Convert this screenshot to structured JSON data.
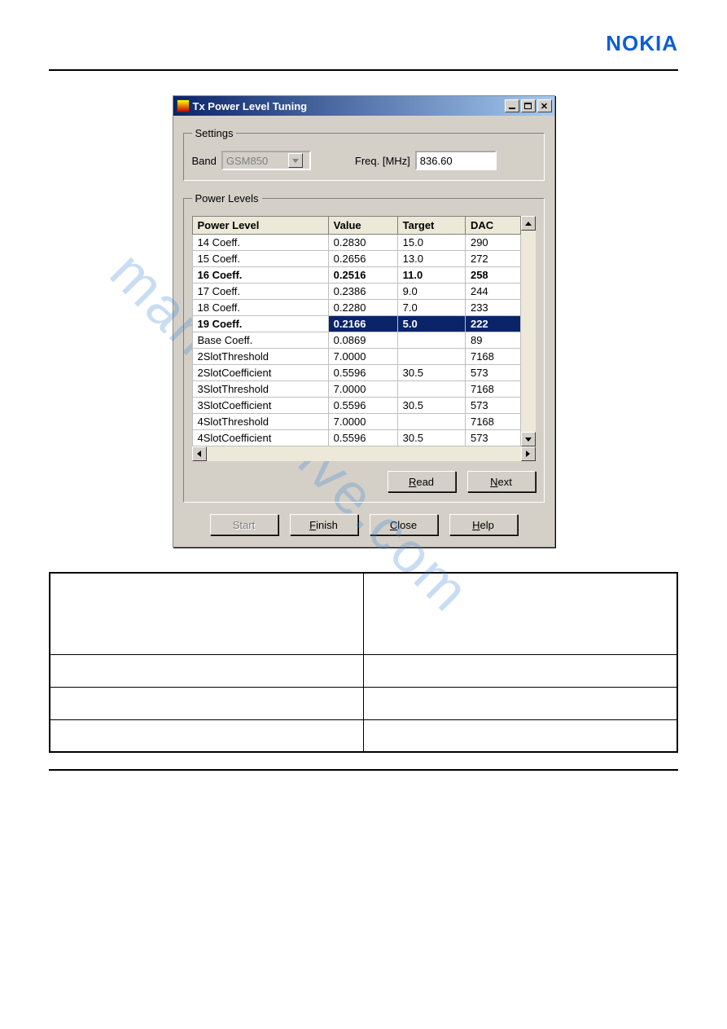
{
  "brand": "NOKIA",
  "watermark": "manualshive.com",
  "dialog": {
    "title": "Tx Power Level Tuning",
    "settings": {
      "legend": "Settings",
      "band_label": "Band",
      "band_value": "GSM850",
      "freq_label": "Freq. [MHz]",
      "freq_value": "836.60"
    },
    "power": {
      "legend": "Power Levels",
      "headers": [
        "Power Level",
        "Value",
        "Target",
        "DAC"
      ],
      "rows": [
        {
          "c": [
            "14 Coeff.",
            "0.2830",
            "15.0",
            "290"
          ],
          "style": ""
        },
        {
          "c": [
            "15 Coeff.",
            "0.2656",
            "13.0",
            "272"
          ],
          "style": ""
        },
        {
          "c": [
            "16 Coeff.",
            "0.2516",
            "11.0",
            "258"
          ],
          "style": "bold"
        },
        {
          "c": [
            "17 Coeff.",
            "0.2386",
            "9.0",
            "244"
          ],
          "style": ""
        },
        {
          "c": [
            "18 Coeff.",
            "0.2280",
            "7.0",
            "233"
          ],
          "style": ""
        },
        {
          "c": [
            "19 Coeff.",
            "0.2166",
            "5.0",
            "222"
          ],
          "style": "selected"
        },
        {
          "c": [
            "Base Coeff.",
            "0.0869",
            "",
            "89"
          ],
          "style": ""
        },
        {
          "c": [
            "2SlotThreshold",
            "7.0000",
            "",
            "7168"
          ],
          "style": ""
        },
        {
          "c": [
            "2SlotCoefficient",
            "0.5596",
            "30.5",
            "573"
          ],
          "style": ""
        },
        {
          "c": [
            "3SlotThreshold",
            "7.0000",
            "",
            "7168"
          ],
          "style": ""
        },
        {
          "c": [
            "3SlotCoefficient",
            "0.5596",
            "30.5",
            "573"
          ],
          "style": ""
        },
        {
          "c": [
            "4SlotThreshold",
            "7.0000",
            "",
            "7168"
          ],
          "style": ""
        },
        {
          "c": [
            "4SlotCoefficient",
            "0.5596",
            "30.5",
            "573"
          ],
          "style": ""
        }
      ],
      "read": "Read",
      "next": "Next"
    },
    "buttons": {
      "start": "Start",
      "finish": "Finish",
      "close": "Close",
      "help": "Help"
    }
  }
}
